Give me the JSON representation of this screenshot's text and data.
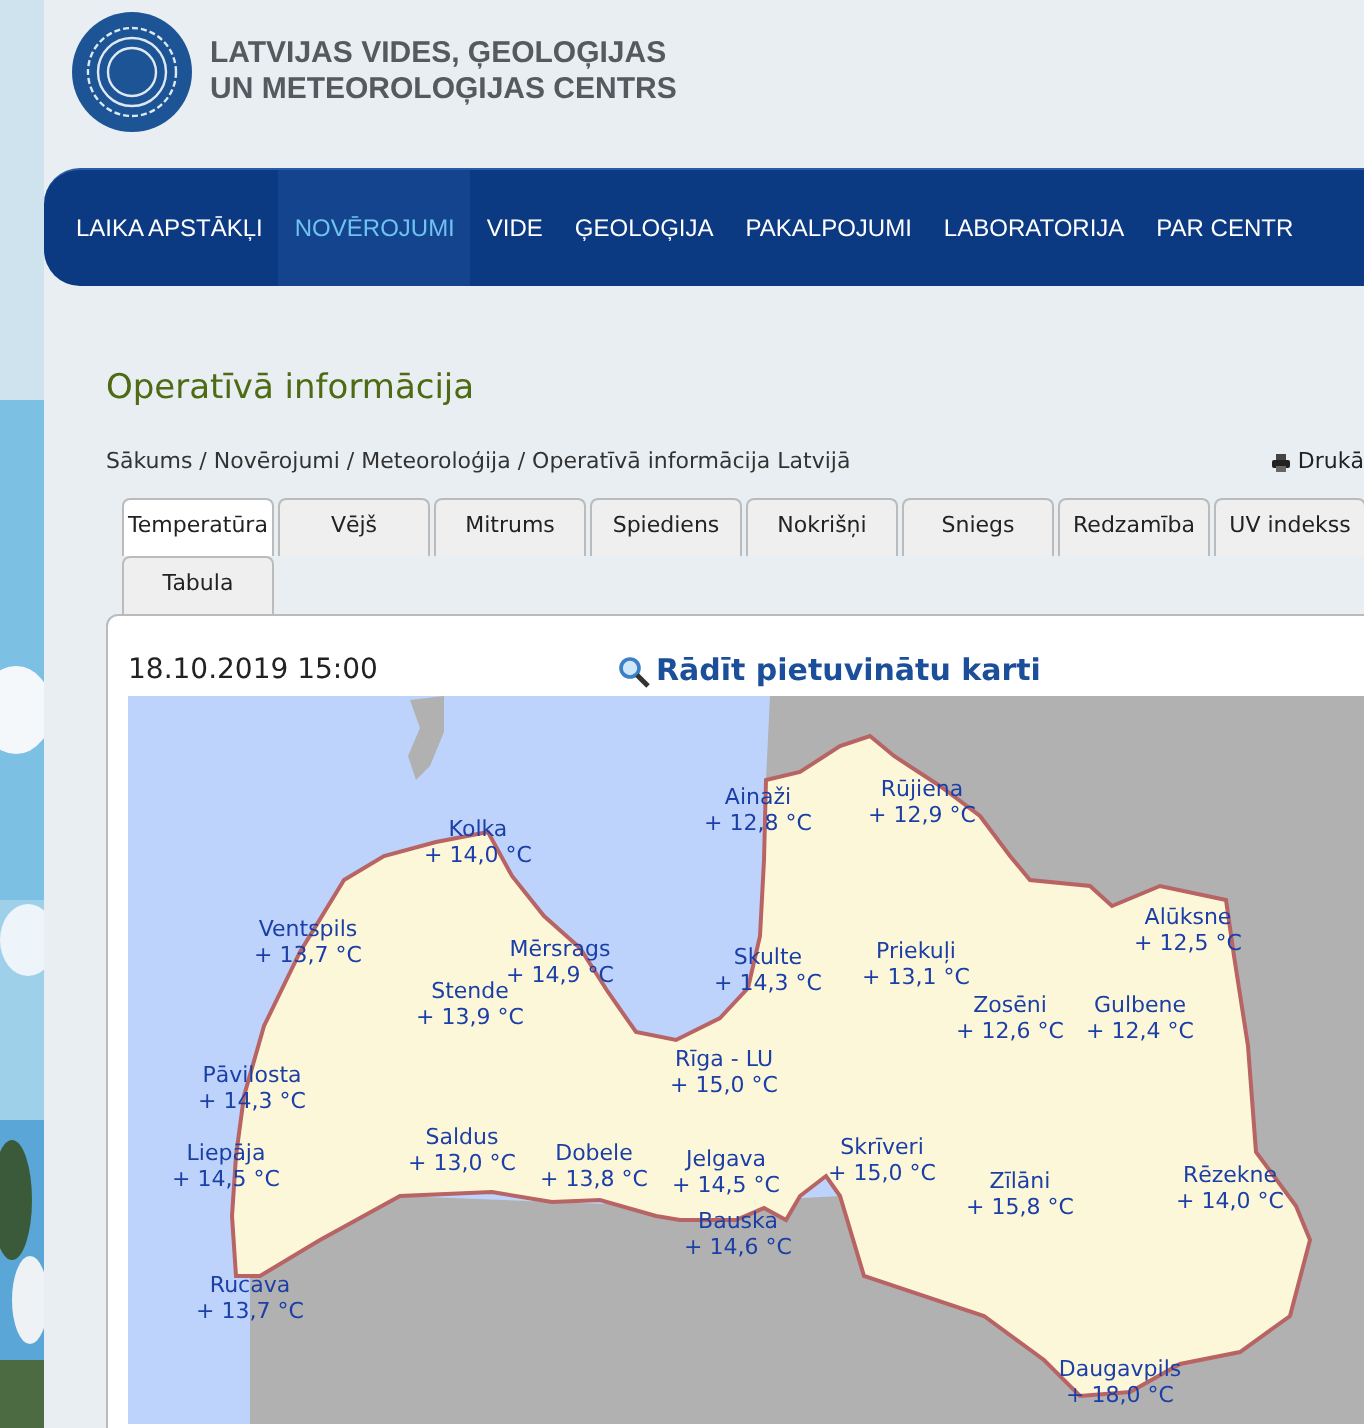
{
  "logo": {
    "line1": "LATVIJAS VIDES, ĢEOLOĢIJAS",
    "line2": "UN METEOROLOĢIJAS CENTRS"
  },
  "nav": [
    {
      "label": "LAIKA APSTĀKĻI",
      "selected": false
    },
    {
      "label": "NOVĒROJUMI",
      "selected": true
    },
    {
      "label": "VIDE",
      "selected": false
    },
    {
      "label": "ĢEOLOĢIJA",
      "selected": false
    },
    {
      "label": "PAKALPOJUMI",
      "selected": false
    },
    {
      "label": "LABORATORIJA",
      "selected": false
    },
    {
      "label": "PAR CENTR",
      "selected": false
    }
  ],
  "page_title": "Operatīvā informācija",
  "breadcrumb": [
    "Sākums",
    "Novērojumi",
    "Meteoroloģija",
    "Operatīvā informācija Latvijā"
  ],
  "breadcrumb_separator": "/",
  "print_link": "Drukā",
  "tabs": [
    {
      "label": "Temperatūra",
      "selected": true
    },
    {
      "label": "Vējš",
      "selected": false
    },
    {
      "label": "Mitrums",
      "selected": false
    },
    {
      "label": "Spiediens",
      "selected": false
    },
    {
      "label": "Nokrišņi",
      "selected": false
    },
    {
      "label": "Sniegs",
      "selected": false
    },
    {
      "label": "Redzamība",
      "selected": false
    },
    {
      "label": "UV indekss",
      "selected": false
    },
    {
      "label": "Tabula",
      "selected": false
    }
  ],
  "timestamp": "18.10.2019 15:00",
  "zoom_map_link": "Rādīt pietuvinātu karti",
  "stations": [
    {
      "name": "Kolka",
      "temp": "+ 14,0 °C"
    },
    {
      "name": "Ainaži",
      "temp": "+ 12,8 °C"
    },
    {
      "name": "Rūjiena",
      "temp": "+ 12,9 °C"
    },
    {
      "name": "Ventspils",
      "temp": "+ 13,7 °C"
    },
    {
      "name": "Mērsrags",
      "temp": "+ 14,9 °C"
    },
    {
      "name": "Skulte",
      "temp": "+ 14,3 °C"
    },
    {
      "name": "Priekuļi",
      "temp": "+ 13,1 °C"
    },
    {
      "name": "Alūksne",
      "temp": "+ 12,5 °C"
    },
    {
      "name": "Stende",
      "temp": "+ 13,9 °C"
    },
    {
      "name": "Zosēni",
      "temp": "+ 12,6 °C"
    },
    {
      "name": "Gulbene",
      "temp": "+ 12,4 °C"
    },
    {
      "name": "Pāvilosta",
      "temp": "+ 14,3 °C"
    },
    {
      "name": "Rīga - LU",
      "temp": "+ 15,0 °C"
    },
    {
      "name": "Liepāja",
      "temp": "+ 14,5 °C"
    },
    {
      "name": "Saldus",
      "temp": "+ 13,0 °C"
    },
    {
      "name": "Dobele",
      "temp": "+ 13,8 °C"
    },
    {
      "name": "Jelgava",
      "temp": "+ 14,5 °C"
    },
    {
      "name": "Skrīveri",
      "temp": "+ 15,0 °C"
    },
    {
      "name": "Zīlāni",
      "temp": "+ 15,8 °C"
    },
    {
      "name": "Rēzekne",
      "temp": "+ 14,0 °C"
    },
    {
      "name": "Bauska",
      "temp": "+ 14,6 °C"
    },
    {
      "name": "Rucava",
      "temp": "+ 13,7 °C"
    },
    {
      "name": "Daugavpils",
      "temp": "+ 18,0 °C"
    }
  ]
}
